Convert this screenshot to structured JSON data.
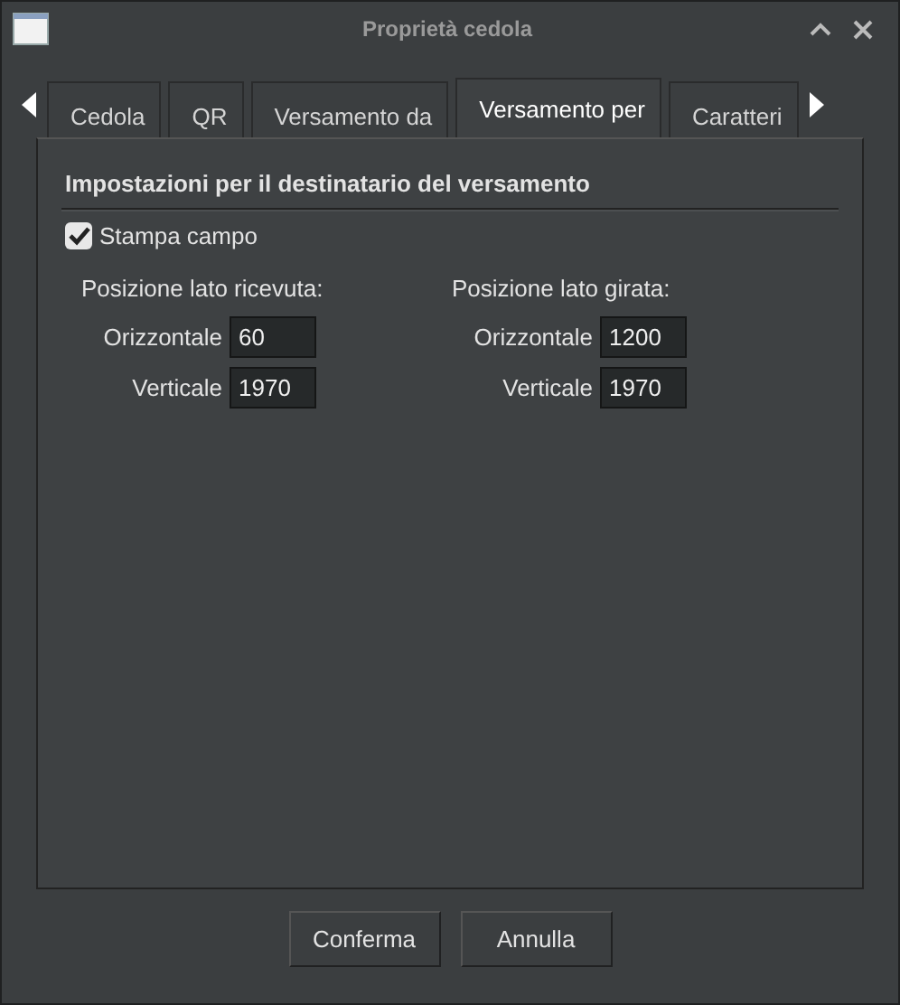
{
  "window": {
    "title": "Proprietà cedola"
  },
  "tabs": [
    {
      "label": "Cedola",
      "selected": false
    },
    {
      "label": "QR",
      "selected": false
    },
    {
      "label": "Versamento da",
      "selected": false
    },
    {
      "label": "Versamento per",
      "selected": true
    },
    {
      "label": "Caratteri",
      "selected": false
    }
  ],
  "section_title": "Impostazioni per il destinatario del versamento",
  "print_field": {
    "label": "Stampa campo",
    "checked": true
  },
  "groups": [
    {
      "title": "Posizione lato ricevuta:",
      "fields": [
        {
          "label": "Orizzontale",
          "value": "60"
        },
        {
          "label": "Verticale",
          "value": "1970"
        }
      ]
    },
    {
      "title": "Posizione lato girata:",
      "fields": [
        {
          "label": "Orizzontale",
          "value": "1200"
        },
        {
          "label": "Verticale",
          "value": "1970"
        }
      ]
    }
  ],
  "buttons": [
    "Conferma",
    "Annulla"
  ]
}
